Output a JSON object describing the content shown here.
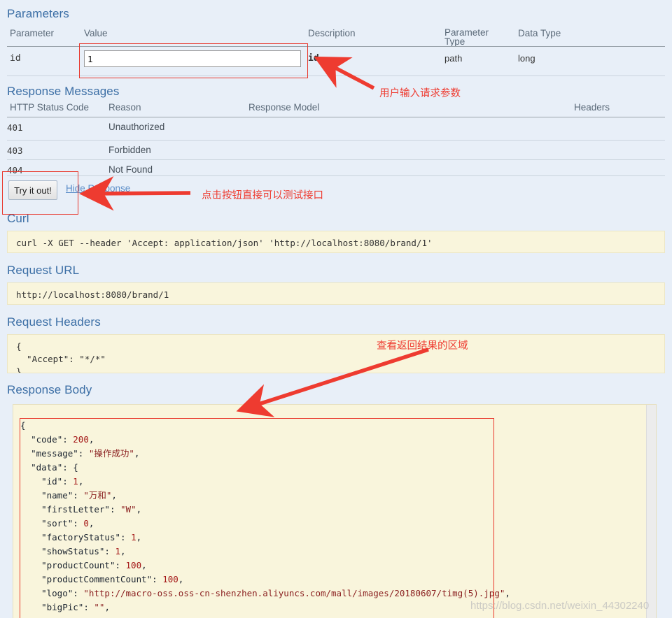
{
  "parameters": {
    "section_title": "Parameters",
    "columns": [
      "Parameter",
      "Value",
      "Description",
      "Parameter Type",
      "Data Type"
    ],
    "param_type_label_line1": "Parameter",
    "param_type_label_line2": "Type",
    "row": {
      "name": "id",
      "value": "1",
      "description": "id",
      "parameter_type": "path",
      "data_type": "long"
    }
  },
  "response_messages": {
    "section_title": "Response Messages",
    "columns": [
      "HTTP Status Code",
      "Reason",
      "Response Model",
      "Headers"
    ],
    "rows": [
      {
        "code": "401",
        "reason": "Unauthorized",
        "model": "",
        "headers": ""
      },
      {
        "code": "403",
        "reason": "Forbidden",
        "model": "",
        "headers": ""
      },
      {
        "code": "404",
        "reason": "Not Found",
        "model": "",
        "headers": ""
      }
    ]
  },
  "actions": {
    "try_it_out": "Try it out!",
    "hide_response": "Hide Response"
  },
  "curl": {
    "title": "Curl",
    "command": "curl -X GET --header 'Accept: application/json' 'http://localhost:8080/brand/1'"
  },
  "request_url": {
    "title": "Request URL",
    "url": "http://localhost:8080/brand/1"
  },
  "request_headers": {
    "title": "Request Headers",
    "body": "{\n  \"Accept\": \"*/*\"\n}"
  },
  "response_body": {
    "title": "Response Body",
    "lines": [
      "{",
      "  \"code\": 200,",
      "  \"message\": \"操作成功\",",
      "  \"data\": {",
      "    \"id\": 1,",
      "    \"name\": \"万和\",",
      "    \"firstLetter\": \"W\",",
      "    \"sort\": 0,",
      "    \"factoryStatus\": 1,",
      "    \"showStatus\": 1,",
      "    \"productCount\": 100,",
      "    \"productCommentCount\": 100,",
      "    \"logo\": \"http://macro-oss.oss-cn-shenzhen.aliyuncs.com/mall/images/20180607/timg(5).jpg\",",
      "    \"bigPic\": \"\","
    ]
  },
  "annotations": [
    {
      "id": "annotation-input",
      "text": "用户输入请求参数"
    },
    {
      "id": "annotation-button",
      "text": "点击按钮直接可以测试接口"
    },
    {
      "id": "annotation-response",
      "text": "查看返回结果的区域"
    }
  ],
  "watermark": "https://blog.csdn.net/weixin_44302240",
  "colors": {
    "heading": "#3b6ea5",
    "annotation": "#ee3b30",
    "code_background": "#f9f5dc",
    "page_background": "#e8eff8"
  }
}
